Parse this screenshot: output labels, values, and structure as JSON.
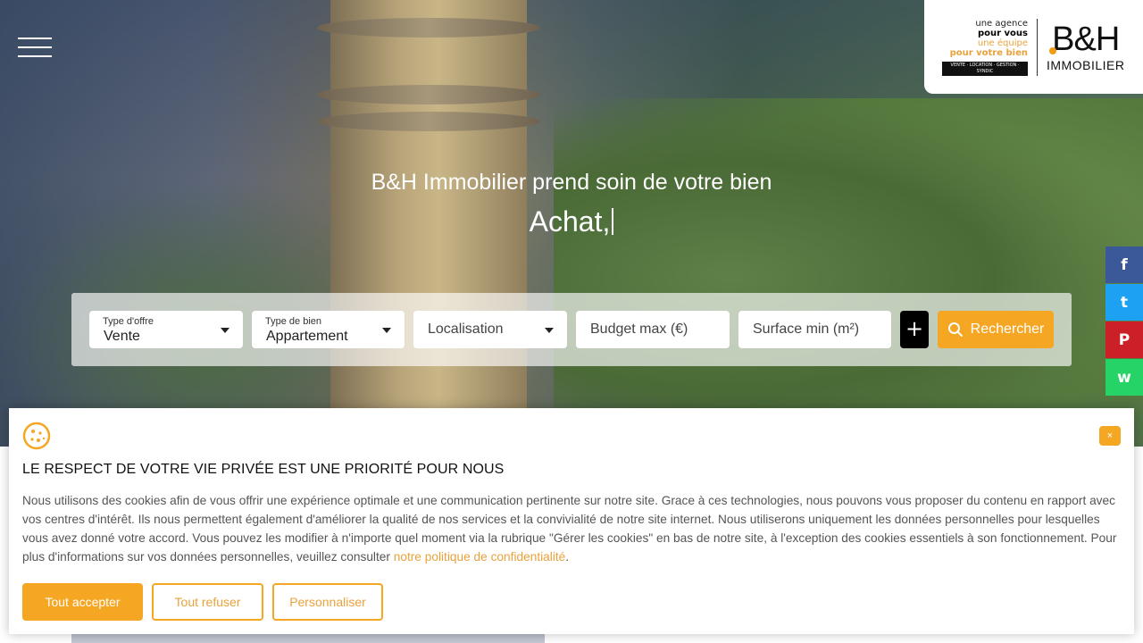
{
  "logo": {
    "tagline_line1": "une agence",
    "tagline_line2": "pour vous",
    "tagline_line3": "une équipe",
    "tagline_line4": "pour votre bien",
    "tagline_services": "VENTE · LOCATION · GESTION · SYNDIC",
    "brand": "B&H",
    "brand_sub": "IMMOBILIER"
  },
  "hero": {
    "title": "B&H Immobilier prend soin de votre bien",
    "typed_text": "Achat,"
  },
  "search": {
    "offer_type": {
      "label": "Type d'offre",
      "value": "Vente"
    },
    "property_type": {
      "label": "Type de bien",
      "value": "Appartement"
    },
    "location": {
      "placeholder": "Localisation"
    },
    "budget": {
      "placeholder": "Budget max (€)"
    },
    "surface": {
      "placeholder": "Surface min (m²)"
    },
    "more_label": "+",
    "submit_label": "Rechercher"
  },
  "social": [
    {
      "name": "facebook",
      "glyph": "f",
      "color": "#3b5998"
    },
    {
      "name": "twitter",
      "glyph": "t",
      "color": "#1da1f2"
    },
    {
      "name": "pinterest",
      "glyph": "P",
      "color": "#cb2027"
    },
    {
      "name": "whatsapp",
      "glyph": "w",
      "color": "#25d366"
    }
  ],
  "cookie": {
    "close_label": "×",
    "title": "LE RESPECT DE VOTRE VIE PRIVÉE EST UNE PRIORITÉ POUR NOUS",
    "body": "Nous utilisons des cookies afin de vous offrir une expérience optimale et une communication pertinente sur notre site. Grace à ces technologies, nous pouvons vous proposer du contenu en rapport avec vos centres d'intérêt. Ils nous permettent également d'améliorer la qualité de nos services et la convivialité de notre site internet. Nous utiliserons uniquement les données personnelles pour lesquelles vous avez donné votre accord. Vous pouvez les modifier à n'importe quel moment via la rubrique \"Gérer les cookies\" en bas de notre site, à l'exception des cookies essentiels à son fonctionnement. Pour plus d'informations sur vos données personnelles, veuillez consulter ",
    "link_text": "notre politique de confidentialité",
    "body_end": ".",
    "accept_label": "Tout accepter",
    "refuse_label": "Tout refuser",
    "customize_label": "Personnaliser"
  },
  "colors": {
    "accent": "#f5a623",
    "plus_button": "#000000"
  }
}
